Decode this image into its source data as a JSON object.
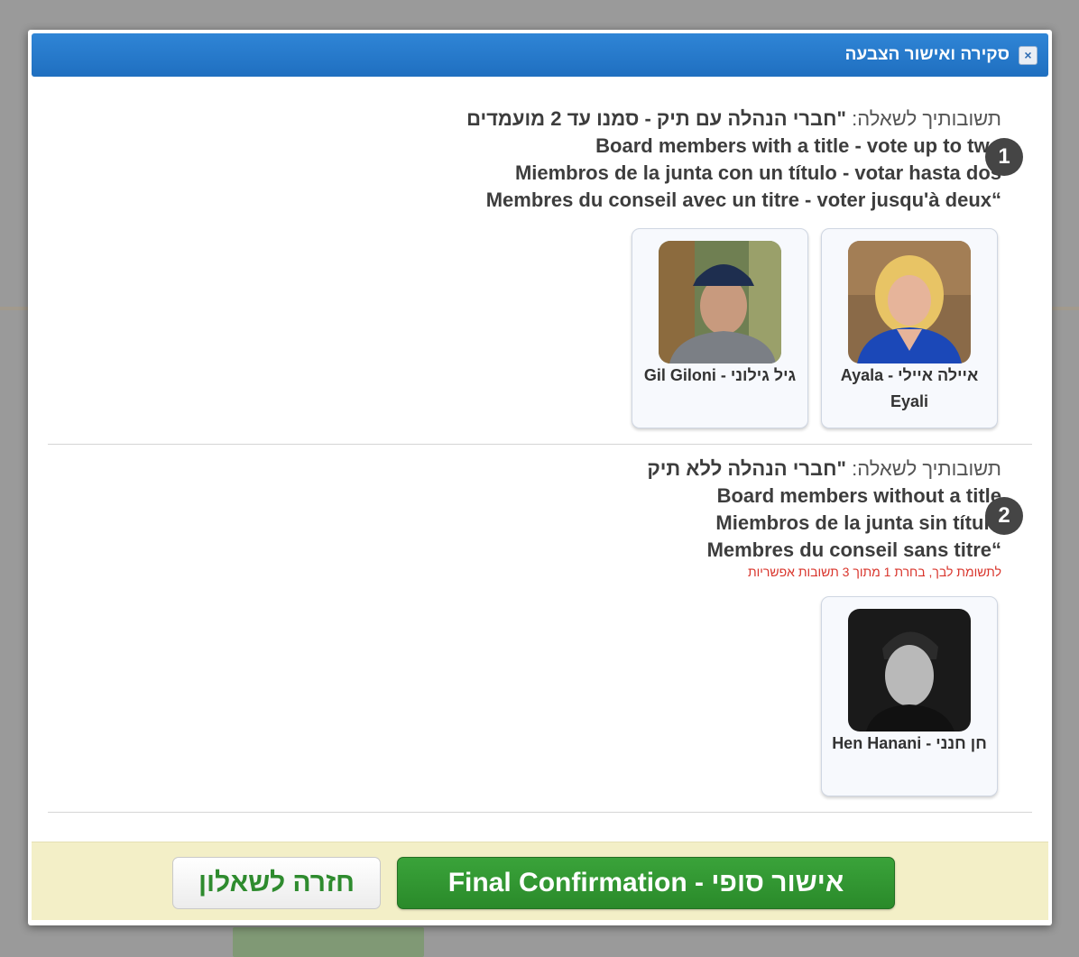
{
  "dialog": {
    "title": "סקירה ואישור הצבעה",
    "close_label": "×"
  },
  "questions": [
    {
      "number": "1",
      "prefix": "תשובותיך לשאלה:",
      "lines": [
        "\"חברי הנהלה עם תיק - סמנו עד 2 מועמדים",
        "Board members with a title - vote up to two",
        "Miembros de la junta con un título - votar hasta dos",
        "“Membres du conseil avec un titre - voter jusqu'à deux"
      ],
      "note": "",
      "candidates": [
        {
          "name": "איילה איילי - Ayala Eyali",
          "photo_icon": "woman-portrait-icon"
        },
        {
          "name": "גיל גילוני - Gil Giloni",
          "photo_icon": "man-portrait-icon"
        }
      ]
    },
    {
      "number": "2",
      "prefix": "תשובותיך לשאלה:",
      "lines": [
        "\"חברי הנהלה ללא תיק",
        "Board members without a title",
        "Miembros de la junta sin título",
        "“Membres du conseil sans titre"
      ],
      "note": "לתשומת לבך, בחרת 1 מתוך 3 תשובות אפשריות",
      "candidates": [
        {
          "name": "חן חנני - Hen Hanani",
          "photo_icon": "young-man-portrait-icon"
        }
      ]
    }
  ],
  "footer": {
    "confirm_label": "אישור סופי - Final Confirmation",
    "back_label": "חזרה לשאלון"
  },
  "colors": {
    "titlebar": "#2777cc",
    "confirm": "#2f932f",
    "note": "#d9342b",
    "footer_bg": "#f3efc7"
  }
}
